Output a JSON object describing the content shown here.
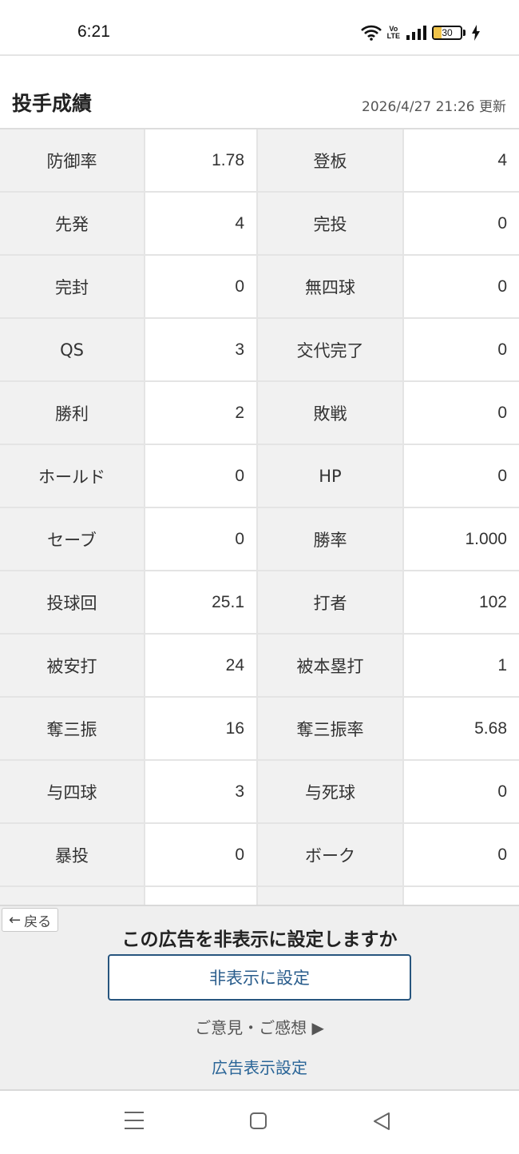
{
  "status_bar": {
    "time": "6:21",
    "volte": "Vo LTE",
    "battery_level": "30",
    "battery_fill_percent": 30,
    "icons": [
      "wifi-icon",
      "volte-icon",
      "signal-icon",
      "battery-icon",
      "charging-icon"
    ]
  },
  "header": {
    "title": "投手成績",
    "updated": "2026/4/27 21:26 更新"
  },
  "stats": {
    "rows": [
      {
        "l1": "防御率",
        "v1": "1.78",
        "l2": "登板",
        "v2": "4"
      },
      {
        "l1": "先発",
        "v1": "4",
        "l2": "完投",
        "v2": "0"
      },
      {
        "l1": "完封",
        "v1": "0",
        "l2": "無四球",
        "v2": "0"
      },
      {
        "l1": "QS",
        "v1": "3",
        "l2": "交代完了",
        "v2": "0"
      },
      {
        "l1": "勝利",
        "v1": "2",
        "l2": "敗戦",
        "v2": "0"
      },
      {
        "l1": "ホールド",
        "v1": "0",
        "l2": "HP",
        "v2": "0"
      },
      {
        "l1": "セーブ",
        "v1": "0",
        "l2": "勝率",
        "v2": "1.000"
      },
      {
        "l1": "投球回",
        "v1": "25.1",
        "l2": "打者",
        "v2": "102"
      },
      {
        "l1": "被安打",
        "v1": "24",
        "l2": "被本塁打",
        "v2": "1"
      },
      {
        "l1": "奪三振",
        "v1": "16",
        "l2": "奪三振率",
        "v2": "5.68"
      },
      {
        "l1": "与四球",
        "v1": "3",
        "l2": "与死球",
        "v2": "0"
      },
      {
        "l1": "暴投",
        "v1": "0",
        "l2": "ボーク",
        "v2": "0"
      }
    ]
  },
  "ad": {
    "back_label": "戻る",
    "title": "この広告を非表示に設定しますか",
    "hide_button": "非表示に設定",
    "feedback": "ご意見・ご感想 ▶",
    "settings_link": "広告表示設定"
  },
  "colors": {
    "label_bg": "#f1f1f1",
    "link": "#2a6597",
    "button_border": "#27557e",
    "battery": "#f0c44a"
  }
}
